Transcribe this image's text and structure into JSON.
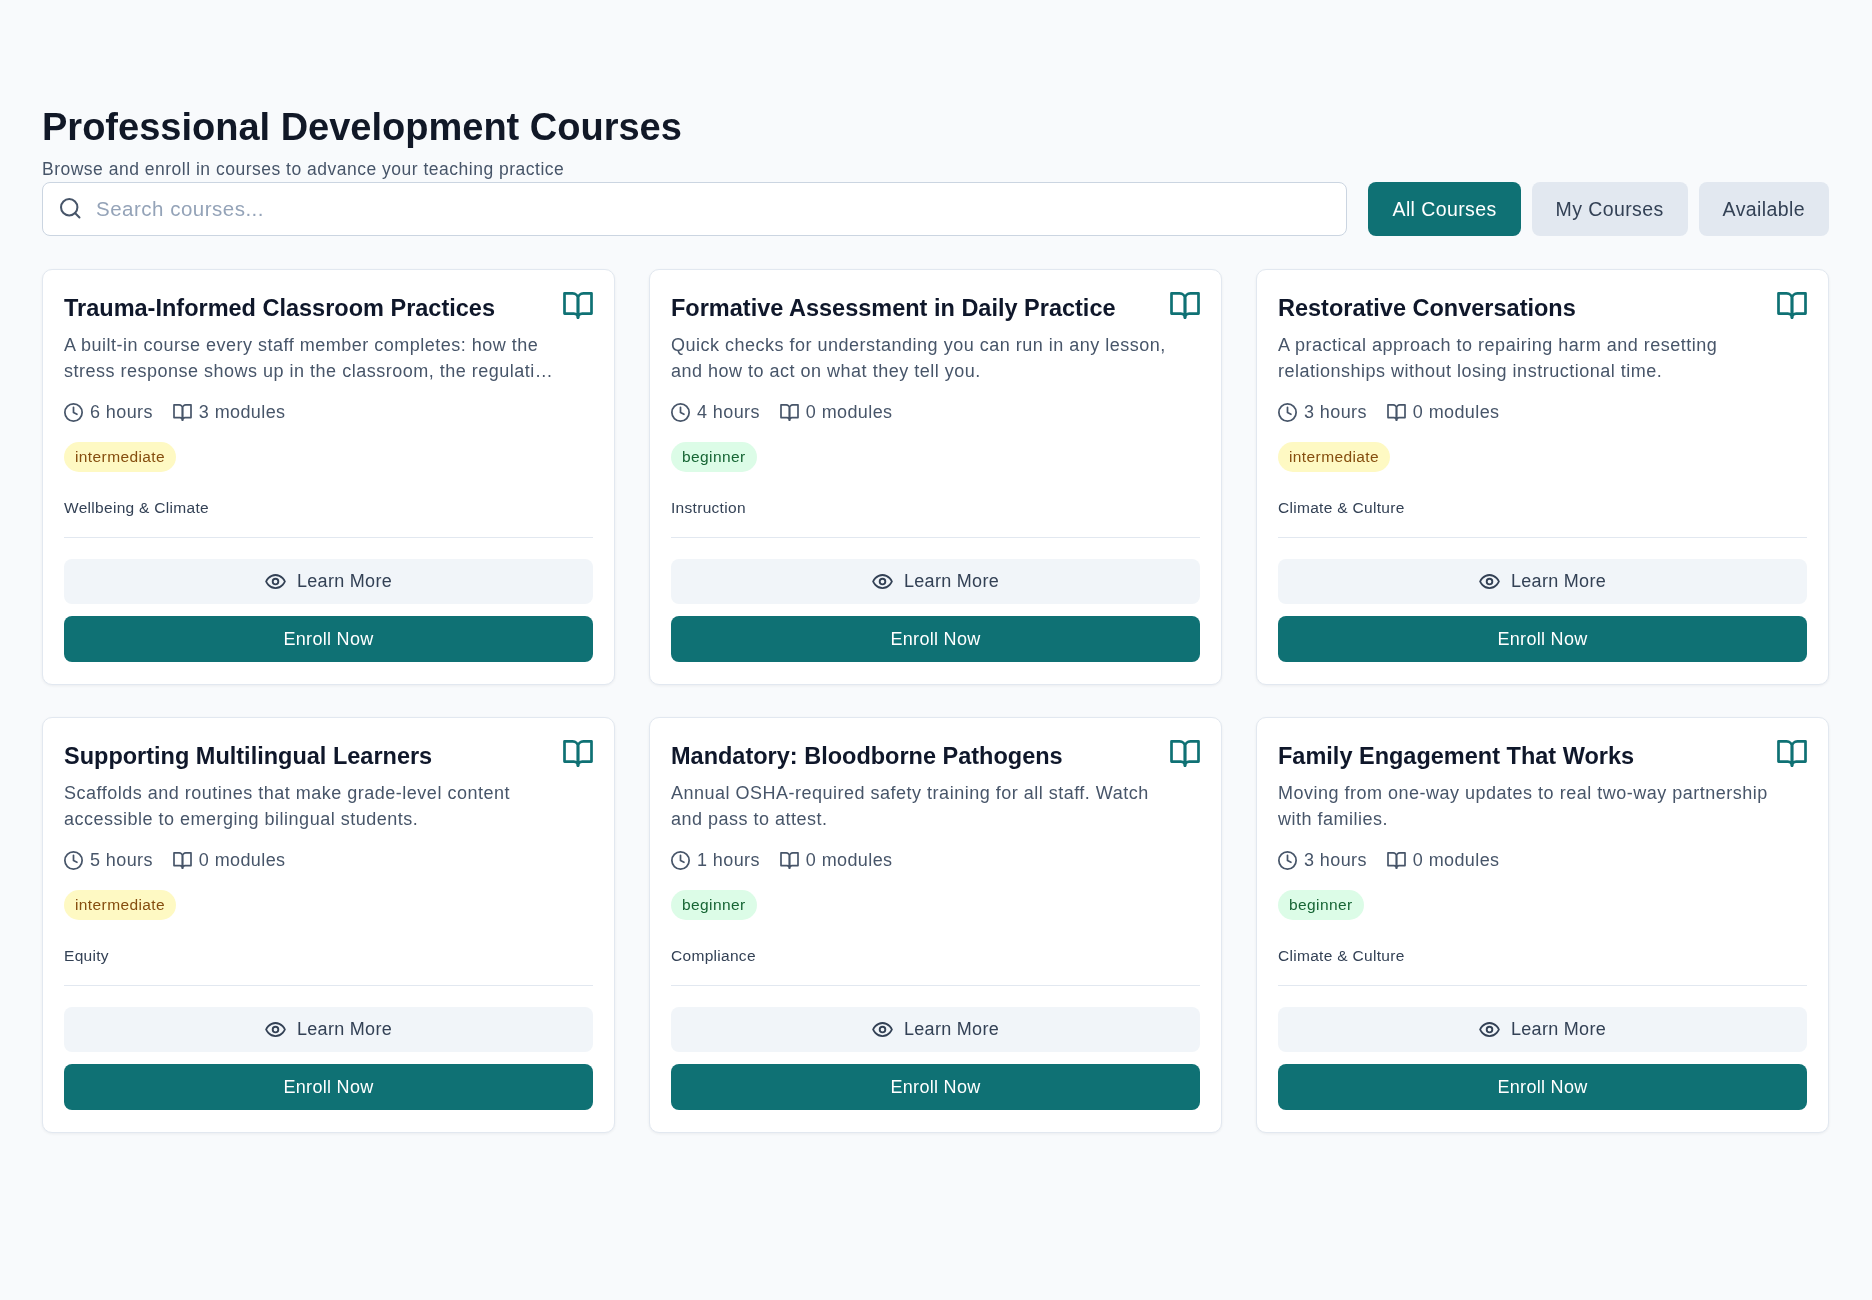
{
  "page": {
    "title": "Professional Development Courses",
    "subtitle": "Browse and enroll in courses to advance your teaching practice"
  },
  "search": {
    "placeholder": "Search courses..."
  },
  "filters": [
    {
      "label": "All Courses",
      "selected": true
    },
    {
      "label": "My Courses",
      "selected": false
    },
    {
      "label": "Available",
      "selected": false
    }
  ],
  "courses": [
    {
      "title": "Trauma-Informed Classroom Practices",
      "description": "A built-in course every staff member completes: how the stress response shows up in the classroom, the regulati…",
      "duration": "6 hours",
      "modules": "3 modules",
      "difficulty": {
        "label": "intermediate",
        "kind": "warning"
      },
      "category": "Wellbeing & Climate",
      "actions": {
        "learn_more": "Learn More",
        "enroll": "Enroll Now"
      }
    },
    {
      "title": "Formative Assessment in Daily Practice",
      "description": "Quick checks for understanding you can run in any lesson, and how to act on what they tell you.",
      "duration": "4 hours",
      "modules": "0 modules",
      "difficulty": {
        "label": "beginner",
        "kind": "success"
      },
      "category": "Instruction",
      "actions": {
        "learn_more": "Learn More",
        "enroll": "Enroll Now"
      }
    },
    {
      "title": "Restorative Conversations",
      "description": "A practical approach to repairing harm and resetting relationships without losing instructional time.",
      "duration": "3 hours",
      "modules": "0 modules",
      "difficulty": {
        "label": "intermediate",
        "kind": "warning"
      },
      "category": "Climate & Culture",
      "actions": {
        "learn_more": "Learn More",
        "enroll": "Enroll Now"
      }
    },
    {
      "title": "Supporting Multilingual Learners",
      "description": "Scaffolds and routines that make grade-level content accessible to emerging bilingual students.",
      "duration": "5 hours",
      "modules": "0 modules",
      "difficulty": {
        "label": "intermediate",
        "kind": "warning"
      },
      "category": "Equity",
      "actions": {
        "learn_more": "Learn More",
        "enroll": "Enroll Now"
      }
    },
    {
      "title": "Mandatory: Bloodborne Pathogens",
      "description": "Annual OSHA-required safety training for all staff. Watch and pass to attest.",
      "duration": "1 hours",
      "modules": "0 modules",
      "difficulty": {
        "label": "beginner",
        "kind": "success"
      },
      "category": "Compliance",
      "actions": {
        "learn_more": "Learn More",
        "enroll": "Enroll Now"
      }
    },
    {
      "title": "Family Engagement That Works",
      "description": "Moving from one-way updates to real two-way partnership with families.",
      "duration": "3 hours",
      "modules": "0 modules",
      "difficulty": {
        "label": "beginner",
        "kind": "success"
      },
      "category": "Climate & Culture",
      "actions": {
        "learn_more": "Learn More",
        "enroll": "Enroll Now"
      }
    }
  ]
}
